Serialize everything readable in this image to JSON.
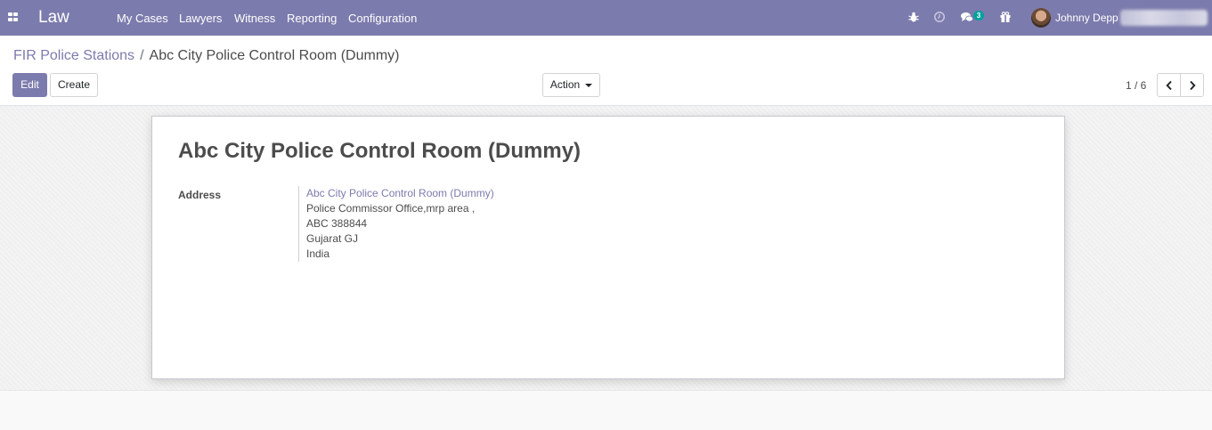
{
  "navbar": {
    "brand": "Law",
    "menu": [
      "My Cases",
      "Lawyers",
      "Witness",
      "Reporting",
      "Configuration"
    ],
    "icons": [
      "apps-grid-icon",
      "bug-icon",
      "clock-icon",
      "chat-icon",
      "gift-icon"
    ],
    "messages_badge": "3",
    "user_name": "Johnny Depp (",
    "color": "#7c7bad"
  },
  "breadcrumb": {
    "parent": "FIR Police Stations",
    "separator": "/",
    "current": "Abc City Police Control Room (Dummy)"
  },
  "buttons": {
    "edit": "Edit",
    "create": "Create",
    "action": "Action"
  },
  "pager": {
    "value": "1 / 6",
    "prev_icon": "chevron-left-icon",
    "next_icon": "chevron-right-icon"
  },
  "record": {
    "title": "Abc City Police Control Room (Dummy)",
    "address_label": "Address",
    "address": {
      "name": "Abc City Police Control Room (Dummy)",
      "street": "Police Commissor Office,mrp area ,",
      "city_zip": "ABC 388844",
      "state": "Gujarat GJ",
      "country": "India"
    }
  }
}
